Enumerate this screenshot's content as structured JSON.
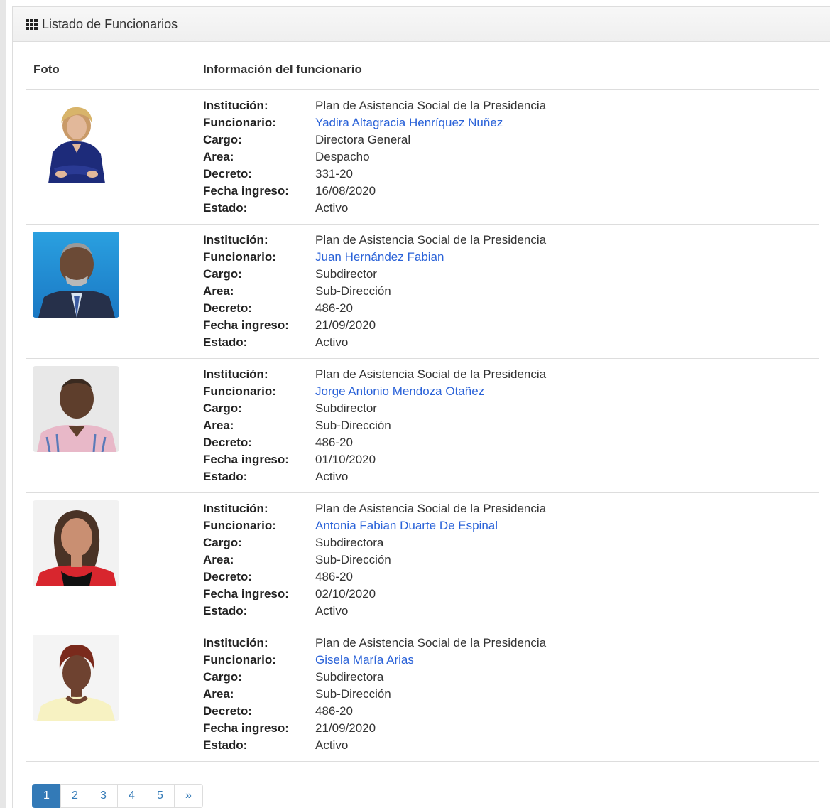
{
  "panel": {
    "title": "Listado de Funcionarios"
  },
  "table": {
    "headers": {
      "foto": "Foto",
      "info": "Información del funcionario"
    },
    "labels": {
      "institucion": "Institución:",
      "funcionario": "Funcionario:",
      "cargo": "Cargo:",
      "area": "Area:",
      "decreto": "Decreto:",
      "fecha": "Fecha ingreso:",
      "estado": "Estado:"
    },
    "rows": [
      {
        "institucion": "Plan de Asistencia Social de la Presidencia",
        "funcionario": "Yadira Altagracia Henríquez Nuñez",
        "cargo": "Directora General",
        "area": "Despacho",
        "decreto": "331-20",
        "fecha": "16/08/2020",
        "estado": "Activo"
      },
      {
        "institucion": "Plan de Asistencia Social de la Presidencia",
        "funcionario": "Juan Hernández Fabian",
        "cargo": "Subdirector",
        "area": "Sub-Dirección",
        "decreto": "486-20",
        "fecha": "21/09/2020",
        "estado": "Activo"
      },
      {
        "institucion": "Plan de Asistencia Social de la Presidencia",
        "funcionario": "Jorge Antonio Mendoza Otañez",
        "cargo": "Subdirector",
        "area": "Sub-Dirección",
        "decreto": "486-20",
        "fecha": "01/10/2020",
        "estado": "Activo"
      },
      {
        "institucion": "Plan de Asistencia Social de la Presidencia",
        "funcionario": "Antonia Fabian Duarte De Espinal",
        "cargo": "Subdirectora",
        "area": "Sub-Dirección",
        "decreto": "486-20",
        "fecha": "02/10/2020",
        "estado": "Activo"
      },
      {
        "institucion": "Plan de Asistencia Social de la Presidencia",
        "funcionario": "Gisela María Arias",
        "cargo": "Subdirectora",
        "area": "Sub-Dirección",
        "decreto": "486-20",
        "fecha": "21/09/2020",
        "estado": "Activo"
      }
    ]
  },
  "pagination": {
    "pages": [
      "1",
      "2",
      "3",
      "4",
      "5"
    ],
    "next": "»",
    "active": "1"
  },
  "colors": {
    "link": "#2a62d8",
    "accent": "#337ab7"
  }
}
